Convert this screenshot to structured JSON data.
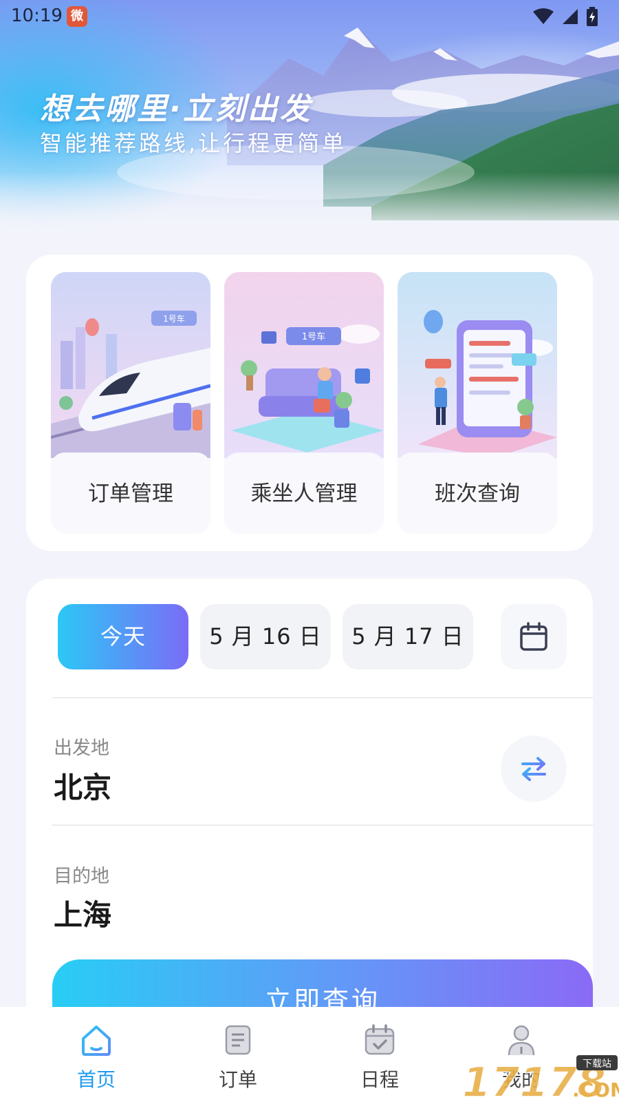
{
  "status_bar": {
    "time": "10:19",
    "app_badge": "微"
  },
  "hero": {
    "title": "想去哪里·立刻出发",
    "subtitle": "智能推荐路线,让行程更简单"
  },
  "features": [
    {
      "label": "订单管理",
      "icon": "train-illustration",
      "sign": "1号车"
    },
    {
      "label": "乘坐人管理",
      "icon": "passenger-illustration",
      "sign": "1号车"
    },
    {
      "label": "班次查询",
      "icon": "schedule-illustration"
    }
  ],
  "dates": [
    {
      "label": "今天",
      "selected": true
    },
    {
      "label": "5 月 16 日",
      "selected": false
    },
    {
      "label": "5 月 17 日",
      "selected": false
    }
  ],
  "calendar_icon": "calendar-icon",
  "departure": {
    "label": "出发地",
    "value": "北京"
  },
  "destination": {
    "label": "目的地",
    "value": "上海"
  },
  "swap_icon": "swap-arrows-icon",
  "query_button": "立即查询",
  "nav": [
    {
      "label": "首页",
      "icon": "home-icon",
      "active": true
    },
    {
      "label": "订单",
      "icon": "order-icon",
      "active": false
    },
    {
      "label": "日程",
      "icon": "schedule-icon",
      "active": false
    },
    {
      "label": "我的",
      "icon": "profile-icon",
      "active": false
    }
  ],
  "watermark": {
    "text": "17178",
    "tag": "下载站",
    "suffix": ".COM"
  },
  "colors": {
    "accent_start": "#2cc8f6",
    "accent_end": "#7a6cf6",
    "nav_active": "#1e9bf0",
    "nav_inactive": "#444444"
  }
}
